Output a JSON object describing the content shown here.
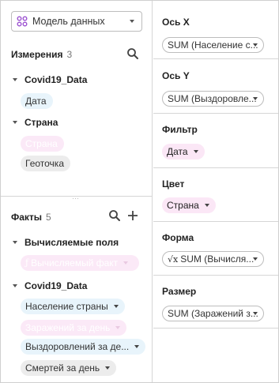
{
  "model": {
    "label": "Модель данных",
    "icon": "data-model-icon"
  },
  "dimensions": {
    "title": "Измерения",
    "count": "3",
    "search_icon": "search-icon",
    "groups": [
      {
        "title": "Covid19_Data",
        "items": [
          {
            "label": "Дата",
            "style": "blue"
          }
        ]
      },
      {
        "title": "Страна",
        "items": [
          {
            "label": "Страна",
            "style": "pink-faded"
          },
          {
            "label": "Геоточка",
            "style": "gray"
          }
        ]
      }
    ]
  },
  "facts": {
    "title": "Факты",
    "count": "5",
    "search_icon": "search-icon",
    "add_icon": "plus-icon",
    "groups": [
      {
        "title": "Вычисляемые поля",
        "items": [
          {
            "label": "Вычисляемый факт",
            "style": "pink-faded",
            "icon": "function-icon"
          }
        ]
      },
      {
        "title": "Covid19_Data",
        "items": [
          {
            "label": "Население страны",
            "style": "blue"
          },
          {
            "label": "Заражений за день",
            "style": "pink-faded"
          },
          {
            "label": "Выздоровлений за де...",
            "style": "blue"
          },
          {
            "label": "Смертей за день",
            "style": "gray"
          }
        ]
      }
    ]
  },
  "slots": [
    {
      "title": "Ось X",
      "value": "SUM (Население с..."
    },
    {
      "title": "Ось Y",
      "value": "SUM (Выздоровле..."
    },
    {
      "title": "Фильтр",
      "value": "Дата"
    },
    {
      "title": "Цвет",
      "value": "Страна"
    },
    {
      "title": "Форма",
      "value": "SUM (Вычисля...",
      "icon": "function-icon"
    },
    {
      "title": "Размер",
      "value": "SUM (Заражений з..."
    }
  ],
  "colors": {
    "blue_chip": "#e8f4fb",
    "pink_chip": "#fbe7f6",
    "gray_chip": "#ececec",
    "border": "#d6d6d6"
  }
}
